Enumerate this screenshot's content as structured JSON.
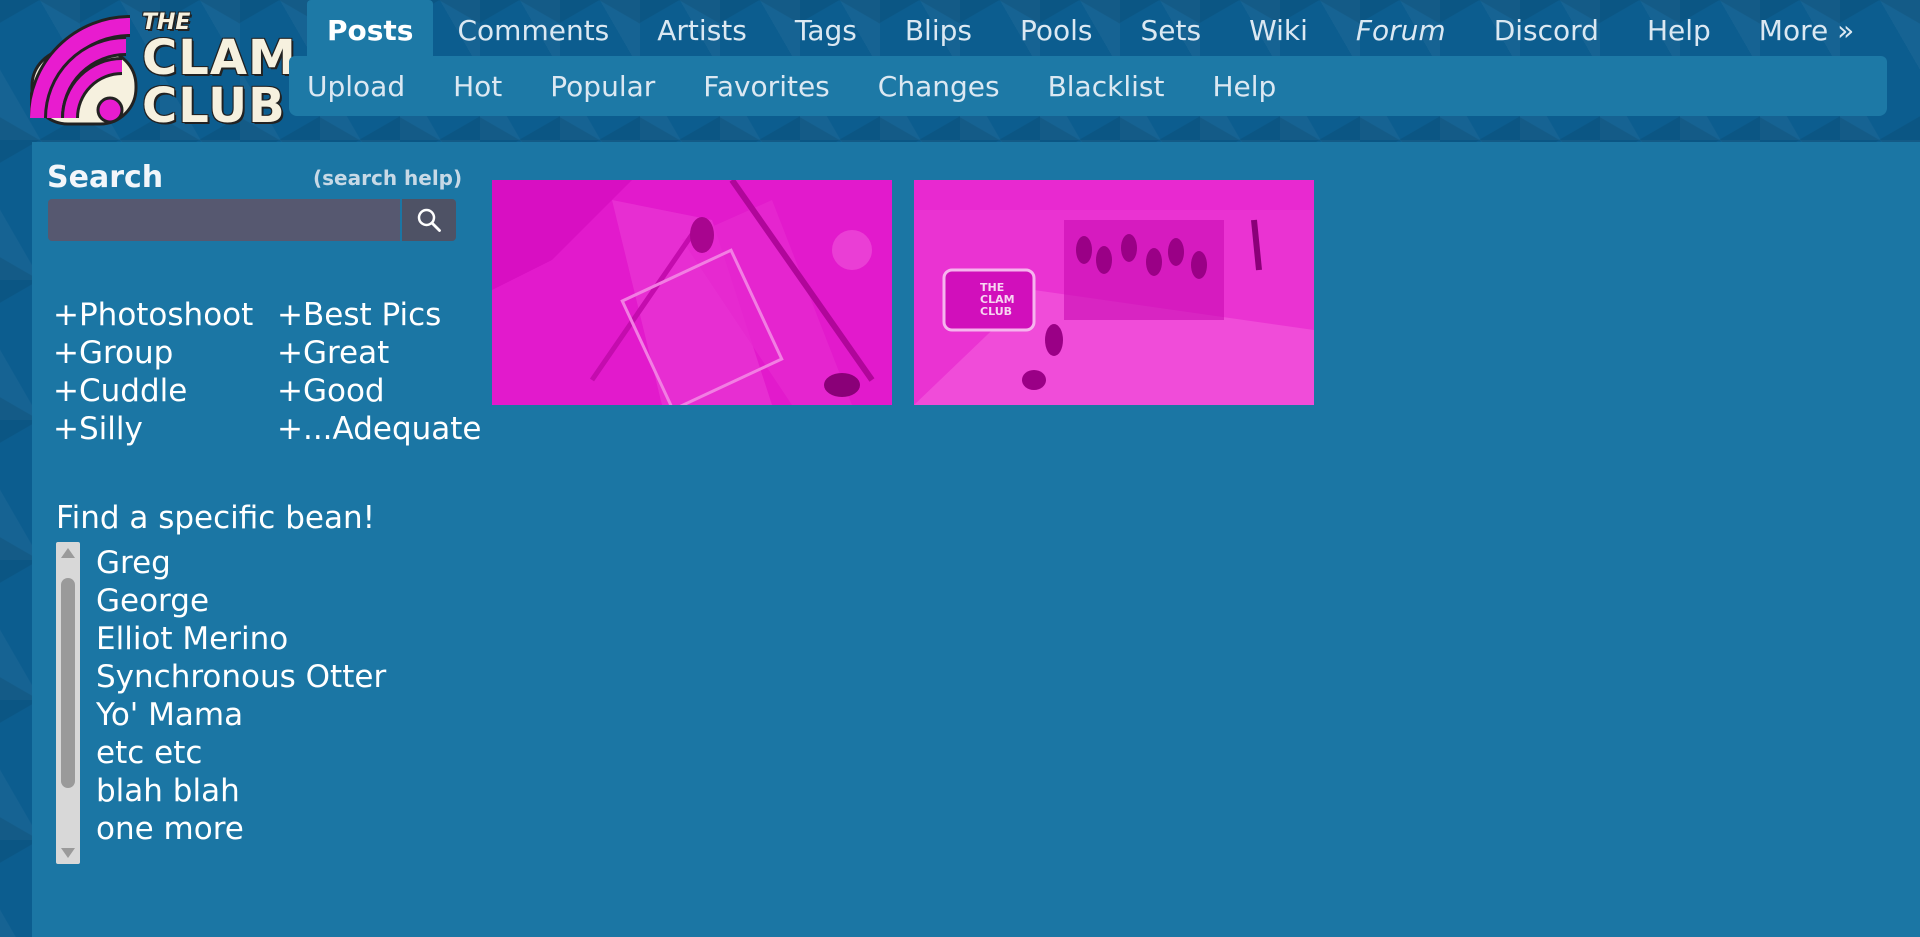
{
  "logo": {
    "the": "THE",
    "clam": "CLAM",
    "club": "CLUB"
  },
  "nav_main": [
    "Posts",
    "Comments",
    "Artists",
    "Tags",
    "Blips",
    "Pools",
    "Sets",
    "Wiki",
    "Forum",
    "Discord",
    "Help",
    "More »"
  ],
  "nav_sub": [
    "Upload",
    "Hot",
    "Popular",
    "Favorites",
    "Changes",
    "Blacklist",
    "Help"
  ],
  "search": {
    "title": "Search",
    "help": "(search help)",
    "placeholder": "",
    "value": "",
    "button_icon": "search-icon"
  },
  "tags_col1": [
    "+Photoshoot",
    "+Group",
    "+Cuddle",
    "+Silly"
  ],
  "tags_col2": [
    "+Best Pics",
    "+Great",
    "+Good",
    "+...Adequate"
  ],
  "bean": {
    "label": "Find a specific bean!",
    "items": [
      "Greg",
      "George",
      "Elliot Merino",
      "Synchronous Otter",
      "Yo' Mama",
      "etc etc",
      "blah blah",
      "one more"
    ]
  },
  "thumb2_logo": {
    "the": "THE",
    "clam": "CLAM",
    "club": "CLUB"
  },
  "colors": {
    "accent": "#1d79a6",
    "background": "#0c5d8f",
    "thumb_tint": "#e61fce"
  }
}
